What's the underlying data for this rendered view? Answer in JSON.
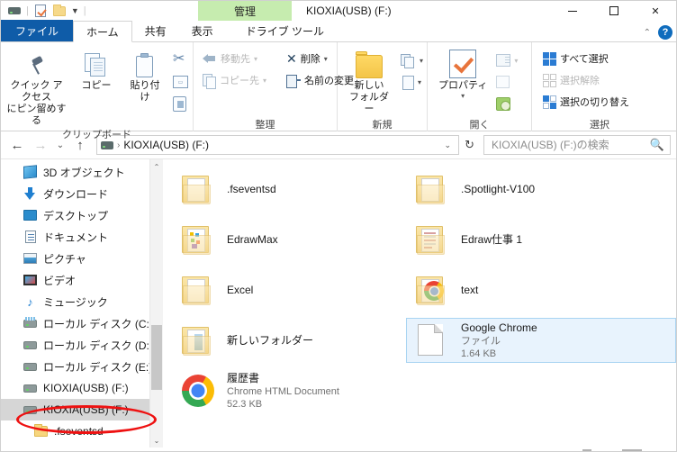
{
  "window": {
    "title": "KIOXIA(USB) (F:)",
    "contextual_tab_header": "管理",
    "minimize_label": "最小化",
    "maximize_label": "最大化",
    "close_label": "閉じる",
    "help_label": "?"
  },
  "quick_access": {
    "drive_icon": "drive-icon",
    "properties_icon": "properties-icon",
    "new_folder_icon": "new-folder-icon",
    "customize_caret": "▼"
  },
  "tabs": [
    {
      "label": "ファイル",
      "type": "file"
    },
    {
      "label": "ホーム",
      "type": "active"
    },
    {
      "label": "共有",
      "type": "normal"
    },
    {
      "label": "表示",
      "type": "normal"
    },
    {
      "label": "ドライブ ツール",
      "type": "contextual"
    }
  ],
  "ribbon": {
    "collapse_caret": "⌃",
    "groups": [
      {
        "name": "clipboard",
        "label": "クリップボード",
        "big_buttons": [
          {
            "label": "クイック アクセス\nにピン留めする",
            "icon": "pin-icon"
          },
          {
            "label": "コピー",
            "icon": "copy-icon"
          },
          {
            "label": "貼り付け",
            "icon": "paste-icon"
          }
        ],
        "small_buttons": [
          {
            "label": "",
            "icon": "cut-icon",
            "dim": false
          },
          {
            "label": "",
            "icon": "copy-path-icon",
            "dim": false
          },
          {
            "label": "",
            "icon": "paste-shortcut-icon",
            "dim": false
          }
        ]
      },
      {
        "name": "organize",
        "label": "整理",
        "small_buttons": [
          {
            "label": "移動先",
            "icon": "move-to-icon",
            "caret": "▾",
            "dim": true
          },
          {
            "label": "コピー先",
            "icon": "copy-to-icon",
            "caret": "▾",
            "dim": true
          },
          {
            "label": "削除",
            "icon": "delete-icon",
            "caret": "▾",
            "dim": false
          },
          {
            "label": "名前の変更",
            "icon": "rename-icon",
            "caret": "",
            "dim": false
          }
        ]
      },
      {
        "name": "new",
        "label": "新規",
        "big_buttons": [
          {
            "label": "新しい\nフォルダー",
            "icon": "new-folder-icon"
          }
        ],
        "small_buttons": [
          {
            "label": "",
            "icon": "new-item-icon",
            "caret": "▾",
            "dim": false
          },
          {
            "label": "",
            "icon": "easy-access-icon",
            "caret": "▾",
            "dim": false
          }
        ]
      },
      {
        "name": "open",
        "label": "開く",
        "big_buttons": [
          {
            "label": "プロパティ",
            "icon": "properties-icon",
            "caret": "▾"
          }
        ],
        "small_buttons": [
          {
            "label": "",
            "icon": "open-icon",
            "caret": "▾",
            "dim": true
          },
          {
            "label": "",
            "icon": "edit-icon",
            "caret": "",
            "dim": true
          },
          {
            "label": "",
            "icon": "history-icon",
            "caret": "",
            "dim": false
          }
        ]
      },
      {
        "name": "select",
        "label": "選択",
        "small_buttons": [
          {
            "label": "すべて選択",
            "icon": "select-all-icon",
            "dim": false
          },
          {
            "label": "選択解除",
            "icon": "select-none-icon",
            "dim": true
          },
          {
            "label": "選択の切り替え",
            "icon": "invert-selection-icon",
            "dim": false
          }
        ]
      }
    ]
  },
  "address_bar": {
    "back_icon": "back-arrow-icon",
    "forward_icon": "forward-arrow-icon",
    "recent_caret": "⌄",
    "up_icon": "up-arrow-icon",
    "drive_icon": "drive-icon",
    "separator": "›",
    "path_text": "KIOXIA(USB) (F:)",
    "dropdown_caret": "⌄",
    "refresh_icon": "↻",
    "search_placeholder": "KIOXIA(USB) (F:)の検索",
    "search_value": "",
    "search_icon": "search-icon"
  },
  "nav_pane": {
    "items": [
      {
        "label": "3D オブジェクト",
        "icon": "3d-objects-icon",
        "indent": 1,
        "state": "normal"
      },
      {
        "label": "ダウンロード",
        "icon": "downloads-icon",
        "indent": 1,
        "state": "normal"
      },
      {
        "label": "デスクトップ",
        "icon": "desktop-icon",
        "indent": 1,
        "state": "normal"
      },
      {
        "label": "ドキュメント",
        "icon": "documents-icon",
        "indent": 1,
        "state": "normal"
      },
      {
        "label": "ピクチャ",
        "icon": "pictures-icon",
        "indent": 1,
        "state": "normal"
      },
      {
        "label": "ビデオ",
        "icon": "videos-icon",
        "indent": 1,
        "state": "normal"
      },
      {
        "label": "ミュージック",
        "icon": "music-icon",
        "indent": 1,
        "state": "normal"
      },
      {
        "label": "ローカル ディスク (C:)",
        "icon": "system-drive-icon",
        "indent": 1,
        "state": "normal"
      },
      {
        "label": "ローカル ディスク (D:)",
        "icon": "drive-icon",
        "indent": 1,
        "state": "normal"
      },
      {
        "label": "ローカル ディスク (E:)",
        "icon": "drive-icon",
        "indent": 1,
        "state": "normal"
      },
      {
        "label": "KIOXIA(USB) (F:)",
        "icon": "drive-icon",
        "indent": 1,
        "state": "normal"
      },
      {
        "label": "KIOXIA(USB) (F:)",
        "icon": "drive-icon",
        "indent": 1,
        "state": "selected"
      },
      {
        "label": ".fseventsd",
        "icon": "folder-icon",
        "indent": 2,
        "state": "normal"
      }
    ],
    "scroll_up_icon": "⌃",
    "scroll_down_icon": "⌄"
  },
  "file_list": {
    "items": [
      {
        "name": ".fseventsd",
        "type": "",
        "size": "",
        "icon": "folder-icon",
        "selected": false
      },
      {
        "name": ".Spotlight-V100",
        "type": "",
        "size": "",
        "icon": "folder-icon",
        "selected": false
      },
      {
        "name": "EdrawMax",
        "type": "",
        "size": "",
        "icon": "folder-preview-colored-icon",
        "selected": false
      },
      {
        "name": "Edraw仕事 1",
        "type": "",
        "size": "",
        "icon": "folder-preview-doc-icon",
        "selected": false
      },
      {
        "name": "Excel",
        "type": "",
        "size": "",
        "icon": "folder-icon",
        "selected": false
      },
      {
        "name": "text",
        "type": "",
        "size": "",
        "icon": "folder-preview-chrome-icon",
        "selected": false
      },
      {
        "name": "新しいフォルダー",
        "type": "",
        "size": "",
        "icon": "folder-preview-blue-icon",
        "selected": false
      },
      {
        "name": "Google Chrome",
        "type": "ファイル",
        "size": "1.64 KB",
        "icon": "generic-file-icon",
        "selected": true
      },
      {
        "name": "履歴書",
        "type": "Chrome HTML Document",
        "size": "52.3 KB",
        "icon": "chrome-icon",
        "selected": false
      }
    ]
  },
  "annotation": {
    "shape": "ellipse",
    "color": "#ee1111",
    "target": "KIOXIA(USB) (F:)"
  },
  "colors": {
    "file_tab_blue": "#0f5ca8",
    "contextual_green": "#c6ecaf",
    "selection_blue": "#e8f3fd",
    "selection_border": "#a8d4f2",
    "nav_selected_grey": "#d6d6d6",
    "annotation_red": "#ee1111"
  }
}
